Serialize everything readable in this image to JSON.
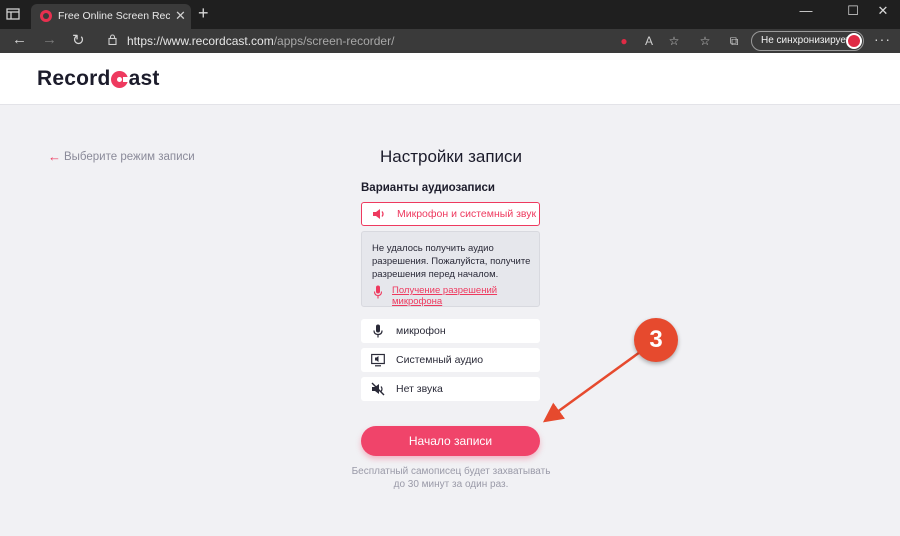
{
  "browser": {
    "tab_title": "Free Online Screen Recorder - Re",
    "url_host": "https://www.recordcast.com",
    "url_path": "/apps/screen-recorder/",
    "sync_label": "Не синхронизируется",
    "new_tab": "+",
    "minimize": "—",
    "maximize": "☐",
    "close": "✕",
    "tab_close": "✕",
    "menu": "···"
  },
  "site": {
    "logo_before": "Record",
    "logo_after": "ast"
  },
  "page": {
    "back_link": "Выберите режим записи",
    "title": "Настройки записи",
    "audio_section_label": "Варианты аудиозаписи",
    "selected_option": "Микрофон и системный звук",
    "warning_text": "Не удалось получить аудио разрешения. Пожалуйста, получите разрешения перед началом.",
    "permission_link": "Получение разрешений микрофона",
    "options": [
      {
        "label": "микрофон",
        "icon": "microphone-icon"
      },
      {
        "label": "Системный аудио",
        "icon": "monitor-audio-icon"
      },
      {
        "label": "Нет звука",
        "icon": "mute-icon"
      }
    ],
    "start_button": "Начало записи",
    "note": "Бесплатный самописец будет захватывать до 30 минут за один раз."
  },
  "annotation": {
    "step": "3"
  },
  "colors": {
    "accent": "#ee3a5f",
    "annotation": "#e64a2e",
    "chrome_dark": "#1f1f1f"
  }
}
